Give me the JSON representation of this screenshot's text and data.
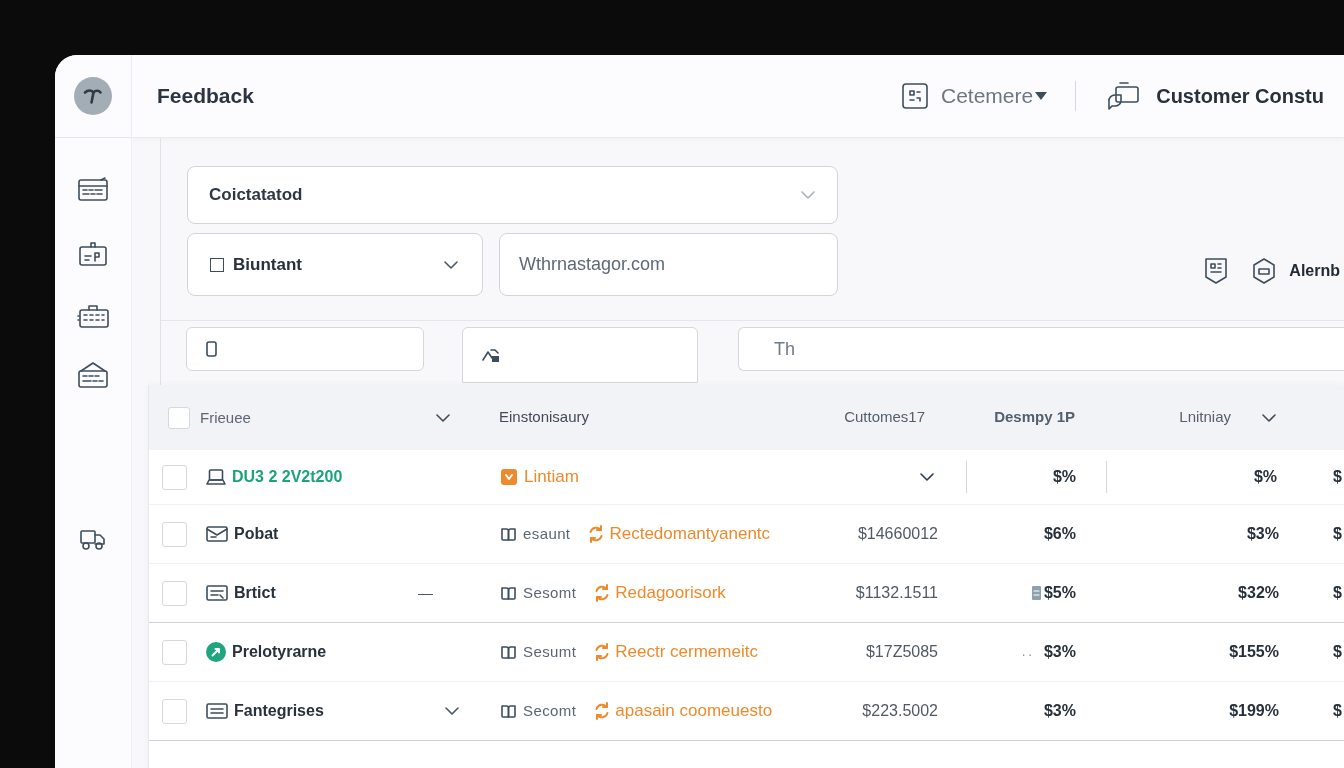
{
  "header": {
    "title": "Feedback",
    "workspace_menu": {
      "label": "Cetemere"
    },
    "account": {
      "name": "Customer Constu"
    }
  },
  "form": {
    "category": {
      "value": "Coictatatod"
    },
    "type": {
      "value": "Biuntant",
      "checked": false
    },
    "website": {
      "value": "Wthrnastagor.com"
    },
    "action": {
      "label": "Alernb"
    }
  },
  "filters": {
    "search": {
      "placeholder": "Th"
    }
  },
  "table": {
    "select_all": {
      "checked": false
    },
    "columns": [
      {
        "label": "Frieuee",
        "menu": true
      },
      {
        "label": "Einstonisaury",
        "menu": false
      },
      {
        "label": "Cuttomes17",
        "menu": false
      },
      {
        "label": "Desmpy 1P",
        "menu": false
      },
      {
        "label": "Lnitniay",
        "menu": true
      }
    ],
    "rows": [
      {
        "kind": "group",
        "checked": false,
        "name": "DU3 2 2V2t200",
        "dropdown": false,
        "category": "Lintiam",
        "share_icon": false,
        "share": "$%",
        "rate": "$%",
        "column_6": "$",
        "divider": false
      },
      {
        "kind": "item",
        "checked": false,
        "name": "Pobat",
        "dropdown": false,
        "type": "esaunt",
        "status": "Rectedomantyanentc",
        "amount": "$14660012",
        "share_icon": false,
        "share": "$6%",
        "rate": "$3%",
        "column_6": "$",
        "divider": false
      },
      {
        "kind": "item",
        "checked": false,
        "name": "Brtict",
        "marker": "—",
        "dropdown": false,
        "type": "Sesomt",
        "status": "Redagoorisork",
        "amount": "$1132.1511",
        "share_icon": true,
        "share": "$5%",
        "rate": "$32%",
        "column_6": "$",
        "divider": true
      },
      {
        "kind": "item",
        "checked": false,
        "name": "Prelotyrarne",
        "dropdown": false,
        "type": "Sesumt",
        "status": "Reectr cermemeitc",
        "amount": "$17Z5085",
        "share_icon": false,
        "share_prefix": ". .",
        "share": "$3%",
        "rate": "$155%",
        "column_6": "$",
        "divider": false
      },
      {
        "kind": "item",
        "checked": false,
        "name": "Fantegrises",
        "dropdown": true,
        "type": "Secomt",
        "status": "apasain coomeuesto",
        "amount": "$223.5002",
        "share_icon": false,
        "share": "$3%",
        "rate": "$199%",
        "column_6": "$",
        "divider": true
      }
    ]
  }
}
